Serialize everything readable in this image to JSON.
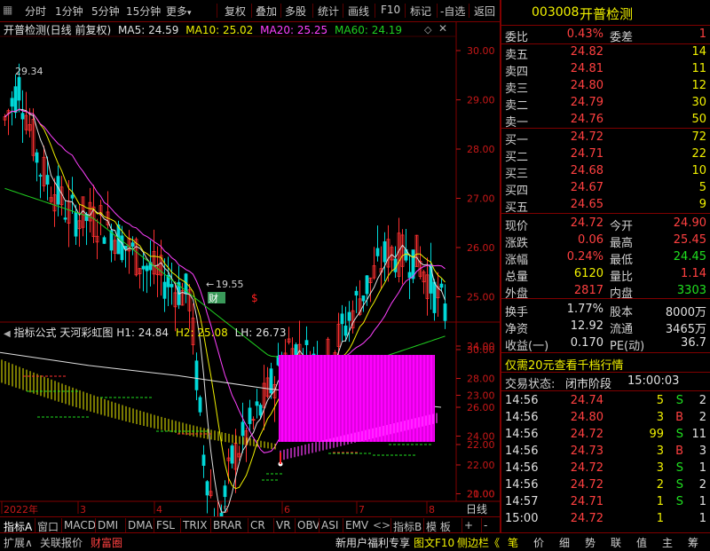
{
  "toolbar": {
    "items": [
      "分时",
      "1分钟",
      "5分钟",
      "15分钟",
      "更多",
      "复权",
      "叠加",
      "多股",
      "统计",
      "画线",
      "F10",
      "标记",
      "-自选",
      "返回"
    ]
  },
  "main": {
    "title": "开普检测(日线 前复权)",
    "ma5": "MA5: 24.59",
    "ma10": "MA10: 25.02",
    "ma20": "MA20: 25.25",
    "ma60": "MA60: 24.19",
    "high_label": "29.34",
    "low_label": "19.55",
    "low_arrow": "←",
    "event_caixun": "财",
    "event_dividend": "$",
    "y_ticks": [
      "30.00",
      "29.00",
      "28.00",
      "27.00",
      "26.00",
      "25.00",
      "24.00",
      "23.00",
      "22.00",
      "21.00",
      "20.00"
    ]
  },
  "indicator": {
    "title": "指标公式 天河彩虹图",
    "h1": "H1: 24.84",
    "h2": "H2: 25.08",
    "lh": "LH: 26.73",
    "y_ticks": [
      "30.00",
      "28.00",
      "26.00",
      "24.00",
      "22.00",
      "20.00"
    ]
  },
  "xaxis": {
    "labels": [
      "2022年",
      "3",
      "4",
      "5",
      "6",
      "7",
      "8"
    ],
    "period": "日线"
  },
  "quote": {
    "code": "003008",
    "name": "开普检测",
    "weibi_label": "委比",
    "weibi": "0.43%",
    "weicha_label": "委差",
    "weicha": "1",
    "sells": [
      {
        "label": "卖五",
        "price": "24.82",
        "vol": "14"
      },
      {
        "label": "卖四",
        "price": "24.81",
        "vol": "11"
      },
      {
        "label": "卖三",
        "price": "24.80",
        "vol": "12"
      },
      {
        "label": "卖二",
        "price": "24.79",
        "vol": "30"
      },
      {
        "label": "卖一",
        "price": "24.76",
        "vol": "50"
      }
    ],
    "buys": [
      {
        "label": "买一",
        "price": "24.72",
        "vol": "72"
      },
      {
        "label": "买二",
        "price": "24.71",
        "vol": "22"
      },
      {
        "label": "买三",
        "price": "24.68",
        "vol": "10"
      },
      {
        "label": "买四",
        "price": "24.67",
        "vol": "5"
      },
      {
        "label": "买五",
        "price": "24.65",
        "vol": "9"
      }
    ],
    "stats": [
      {
        "l1": "现价",
        "v1": "24.72",
        "c1": "red",
        "l2": "今开",
        "v2": "24.90",
        "c2": "red"
      },
      {
        "l1": "涨跌",
        "v1": "0.06",
        "c1": "red",
        "l2": "最高",
        "v2": "25.45",
        "c2": "red"
      },
      {
        "l1": "涨幅",
        "v1": "0.24%",
        "c1": "red",
        "l2": "最低",
        "v2": "24.45",
        "c2": "grn"
      },
      {
        "l1": "总量",
        "v1": "6120",
        "c1": "yel",
        "l2": "量比",
        "v2": "1.14",
        "c2": "red"
      },
      {
        "l1": "外盘",
        "v1": "2817",
        "c1": "red",
        "l2": "内盘",
        "v2": "3303",
        "c2": "grn"
      }
    ],
    "stats2": [
      {
        "l1": "换手",
        "v1": "1.77%",
        "l2": "股本",
        "v2": "8000万"
      },
      {
        "l1": "净资",
        "v1": "12.92",
        "l2": "流通",
        "v2": "3465万"
      },
      {
        "l1": "收益(一)",
        "v1": "0.170",
        "l2": "PE(动)",
        "v2": "36.7"
      }
    ],
    "promo": "仅需20元查看千档行情",
    "status_label": "交易状态:",
    "status_value": "闭市阶段",
    "status_time": "15:00:03",
    "ticks": [
      {
        "t": "14:56",
        "p": "24.74",
        "v": "5",
        "s": "S",
        "n": "2"
      },
      {
        "t": "14:56",
        "p": "24.80",
        "v": "3",
        "s": "B",
        "n": "2"
      },
      {
        "t": "14:56",
        "p": "24.72",
        "v": "99",
        "s": "S",
        "n": "11"
      },
      {
        "t": "14:56",
        "p": "24.73",
        "v": "3",
        "s": "B",
        "n": "3"
      },
      {
        "t": "14:56",
        "p": "24.72",
        "v": "3",
        "s": "S",
        "n": "1"
      },
      {
        "t": "14:56",
        "p": "24.72",
        "v": "2",
        "s": "S",
        "n": "2"
      },
      {
        "t": "14:57",
        "p": "24.71",
        "v": "1",
        "s": "S",
        "n": "1"
      },
      {
        "t": "15:00",
        "p": "24.72",
        "v": "1",
        "s": "",
        "n": "1"
      }
    ]
  },
  "tabs1": [
    "指标A",
    "窗口",
    "MACD",
    "DMI",
    "DMA",
    "FSL",
    "TRIX",
    "BRAR",
    "CR",
    "VR",
    "OBV",
    "ASI",
    "EMV",
    "指标B",
    "模 板",
    "+",
    "-"
  ],
  "tabs2": {
    "left": [
      "扩展∧",
      "关联报价",
      "财富圈"
    ],
    "right": [
      "新用户福利专享",
      "图文F10",
      "侧边栏《"
    ],
    "side": [
      "笔",
      "价",
      "细",
      "势",
      "联",
      "值",
      "主",
      "筹"
    ]
  },
  "colors": {
    "up": "#ff3030",
    "down": "#00d8d8",
    "ma5": "#e0e0e0",
    "ma10": "#f0f000",
    "ma20": "#ff40ff",
    "ma60": "#20d020",
    "frame": "#800000"
  }
}
